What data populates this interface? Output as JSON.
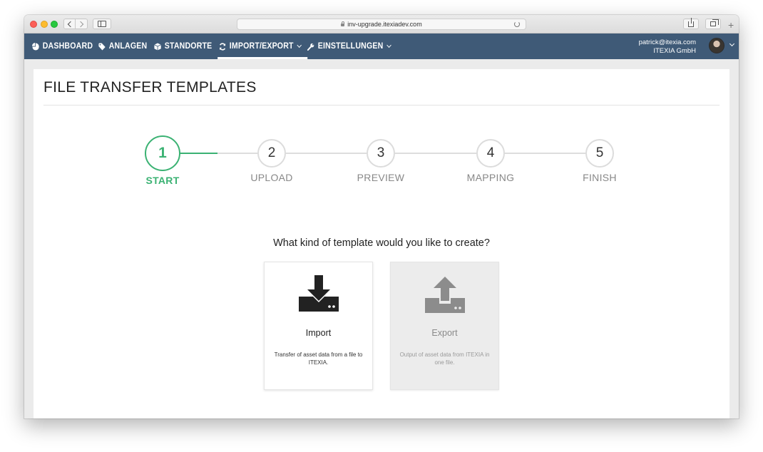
{
  "browser": {
    "url": "inv-upgrade.itexiadev.com",
    "new_tab_symbol": "+"
  },
  "nav": {
    "items": [
      {
        "label": "DASHBOARD",
        "icon": "dashboard-icon"
      },
      {
        "label": "ANLAGEN",
        "icon": "tag-icon"
      },
      {
        "label": "STANDORTE",
        "icon": "cube-icon"
      },
      {
        "label": "IMPORT/EXPORT",
        "icon": "refresh-icon",
        "active": true
      },
      {
        "label": "EINSTELLUNGEN",
        "icon": "wrench-icon"
      }
    ],
    "user_email": "patrick@itexia.com",
    "company": "ITEXIA GmbH"
  },
  "page": {
    "title": "FILE TRANSFER TEMPLATES"
  },
  "wizard": {
    "steps": [
      {
        "number": "1",
        "label": "START",
        "active": true
      },
      {
        "number": "2",
        "label": "UPLOAD"
      },
      {
        "number": "3",
        "label": "PREVIEW"
      },
      {
        "number": "4",
        "label": "MAPPING"
      },
      {
        "number": "5",
        "label": "FINISH"
      }
    ],
    "question": "What kind of template would you like to create?"
  },
  "options": {
    "import": {
      "title": "Import",
      "description": "Transfer of asset data from a file to ITEXIA.",
      "icon": "download-icon"
    },
    "export": {
      "title": "Export",
      "description": "Output of asset data from ITEXIA in one file.",
      "icon": "upload-icon"
    }
  },
  "colors": {
    "nav_bg": "#3f5a77",
    "accent": "#3bb273"
  }
}
